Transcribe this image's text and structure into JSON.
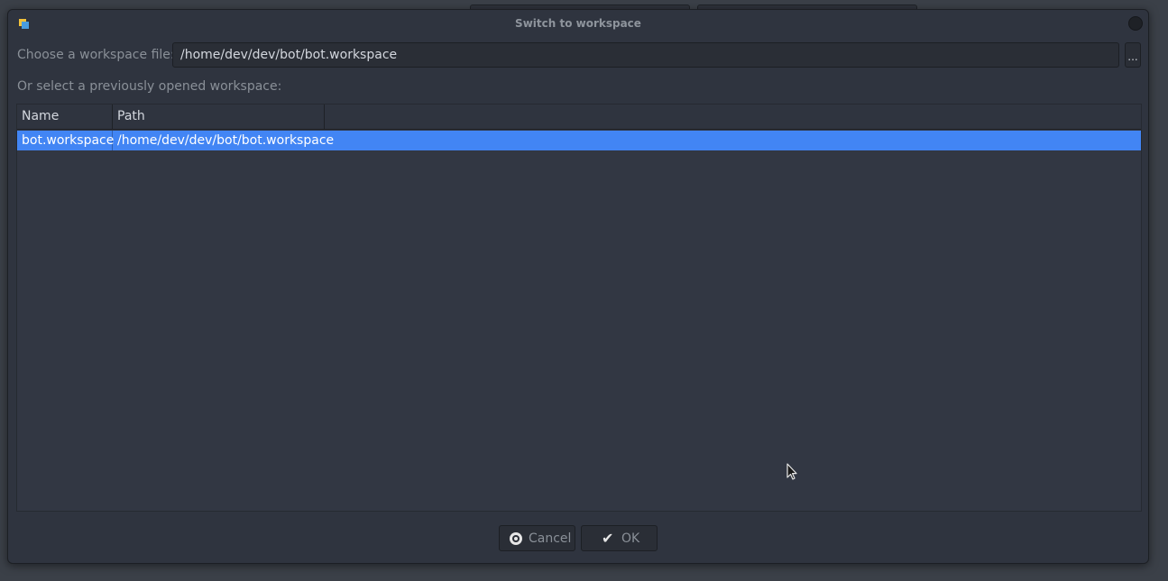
{
  "dialog": {
    "title": "Switch to workspace"
  },
  "file_chooser": {
    "label": "Choose a workspace file:",
    "value": "/home/dev/dev/bot/bot.workspace",
    "browse_label": "..."
  },
  "recent": {
    "label": "Or select a previously opened workspace:",
    "columns": [
      "Name",
      "Path"
    ],
    "rows": [
      {
        "name": "bot.workspace",
        "path": "/home/dev/dev/bot/bot.workspace",
        "selected": true
      }
    ]
  },
  "buttons": {
    "cancel_label": "Cancel",
    "ok_label": "OK"
  },
  "colors": {
    "selection": "#4285f4",
    "dialog_bg": "#2f343f"
  },
  "icons": {
    "app": "app-icon",
    "close": "close-icon",
    "cancel": "cancel-icon",
    "ok": "check-icon",
    "pointer": "mouse-pointer-icon"
  }
}
